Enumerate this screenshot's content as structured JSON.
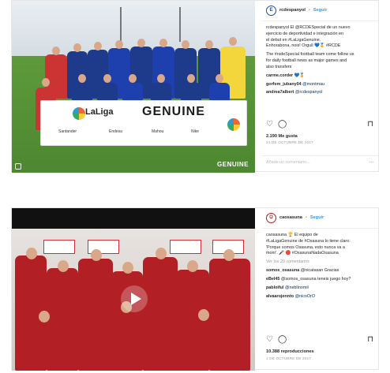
{
  "posts": [
    {
      "username": "rcdespanyol",
      "avatar_text": "E",
      "follow": "Seguir",
      "caption_lines": [
        "rcdespanyol El @RCDESpecial de un nuevo",
        "ejercicio de deportividad e integración en",
        "el debut en #LaLigaGenuine.",
        "Enhorabona, nois! Orgull 💙🏅 #RCDE",
        "",
        "The #rcdeSpecial football team come follow us",
        "for daily football news as major games and",
        "also transfers"
      ],
      "comments": [
        {
          "user": "carme.corder",
          "text": "💙🏅"
        },
        {
          "user": "gorfem_jubany04",
          "text": "@montmau"
        },
        {
          "user": "andrea7albert",
          "text": "@rcdespanyol"
        }
      ],
      "likes": "2.190 Me gusta",
      "date": "21 DE OCTUBRE DE 2017",
      "add_comment": "Añade un comentario...",
      "more": "···",
      "banner": {
        "laliga": "LaLiga",
        "genuine": "GENUINE",
        "sponsors": [
          "Santander",
          "Endesa",
          "Mahou",
          "Nike"
        ],
        "watermark": "GENUINE"
      }
    },
    {
      "username": "caosasuna",
      "avatar_text": "O",
      "follow": "Seguir",
      "caption_lines": [
        "caosasuna 🏆 El equipo de",
        "#LaLigaGenuine de #Osasuna lo tiene claro:",
        "'Porque somos Osasuna, esto nunca va a",
        "morir'. 🎤 🔴 #OsasunaNadaOsasuna"
      ],
      "view_all": "Ver los 20 comentarios",
      "comments": [
        {
          "user": "somos_osasuna",
          "text": "@nicatasan Gracias"
        },
        {
          "user": "eBel45",
          "text": "@somos_osasuna teneis juego hoy?"
        },
        {
          "user": "pabloiful",
          "text": "@neblinomil"
        },
        {
          "user": "alvaarojennto",
          "text": "@nicoOrO"
        }
      ],
      "likes": "10.388 reproducciones",
      "date": "1 DE OCTUBRE DE 2017"
    }
  ]
}
